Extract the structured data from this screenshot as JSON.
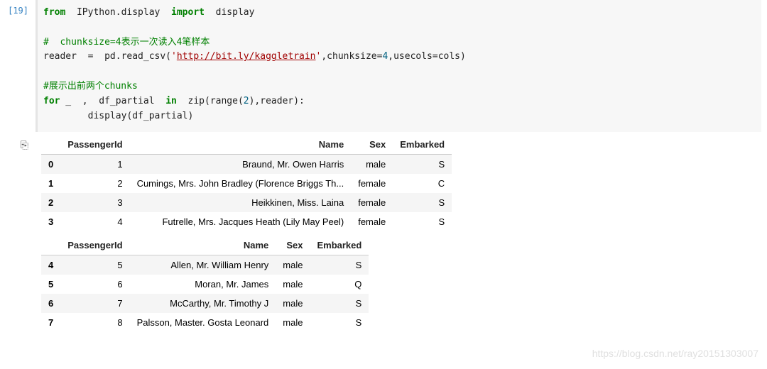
{
  "prompt": "[19]",
  "code": {
    "line1_from": "from",
    "line1_module": "IPython.display",
    "line1_import": "import",
    "line1_name": "display",
    "line3_comment": "#  chunksize=4表示一次读入4笔样本",
    "line4a": "reader  =  pd.read_csv(",
    "line4_quote1": "'",
    "line4_url": "http://bit.ly/kaggletrain",
    "line4_quote2": "'",
    "line4b": ",chunksize=",
    "line4_num": "4",
    "line4c": ",usecols=cols)",
    "line6_comment": "#展示出前两个chunks",
    "line7_for": "for",
    "line7_a": " _  ,  df_partial  ",
    "line7_in": "in",
    "line7_b": "  zip(range(",
    "line7_num": "2",
    "line7_c": "),reader):",
    "line8": "        display(df_partial)"
  },
  "table1": {
    "headers": [
      "",
      "PassengerId",
      "Name",
      "Sex",
      "Embarked"
    ],
    "rows": [
      [
        "0",
        "1",
        "Braund, Mr. Owen Harris",
        "male",
        "S"
      ],
      [
        "1",
        "2",
        "Cumings, Mrs. John Bradley (Florence Briggs Th...",
        "female",
        "C"
      ],
      [
        "2",
        "3",
        "Heikkinen, Miss. Laina",
        "female",
        "S"
      ],
      [
        "3",
        "4",
        "Futrelle, Mrs. Jacques Heath (Lily May Peel)",
        "female",
        "S"
      ]
    ]
  },
  "table2": {
    "headers": [
      "",
      "PassengerId",
      "Name",
      "Sex",
      "Embarked"
    ],
    "rows": [
      [
        "4",
        "5",
        "Allen, Mr. William Henry",
        "male",
        "S"
      ],
      [
        "5",
        "6",
        "Moran, Mr. James",
        "male",
        "Q"
      ],
      [
        "6",
        "7",
        "McCarthy, Mr. Timothy J",
        "male",
        "S"
      ],
      [
        "7",
        "8",
        "Palsson, Master. Gosta Leonard",
        "male",
        "S"
      ]
    ]
  },
  "watermark": "https://blog.csdn.net/ray20151303007"
}
